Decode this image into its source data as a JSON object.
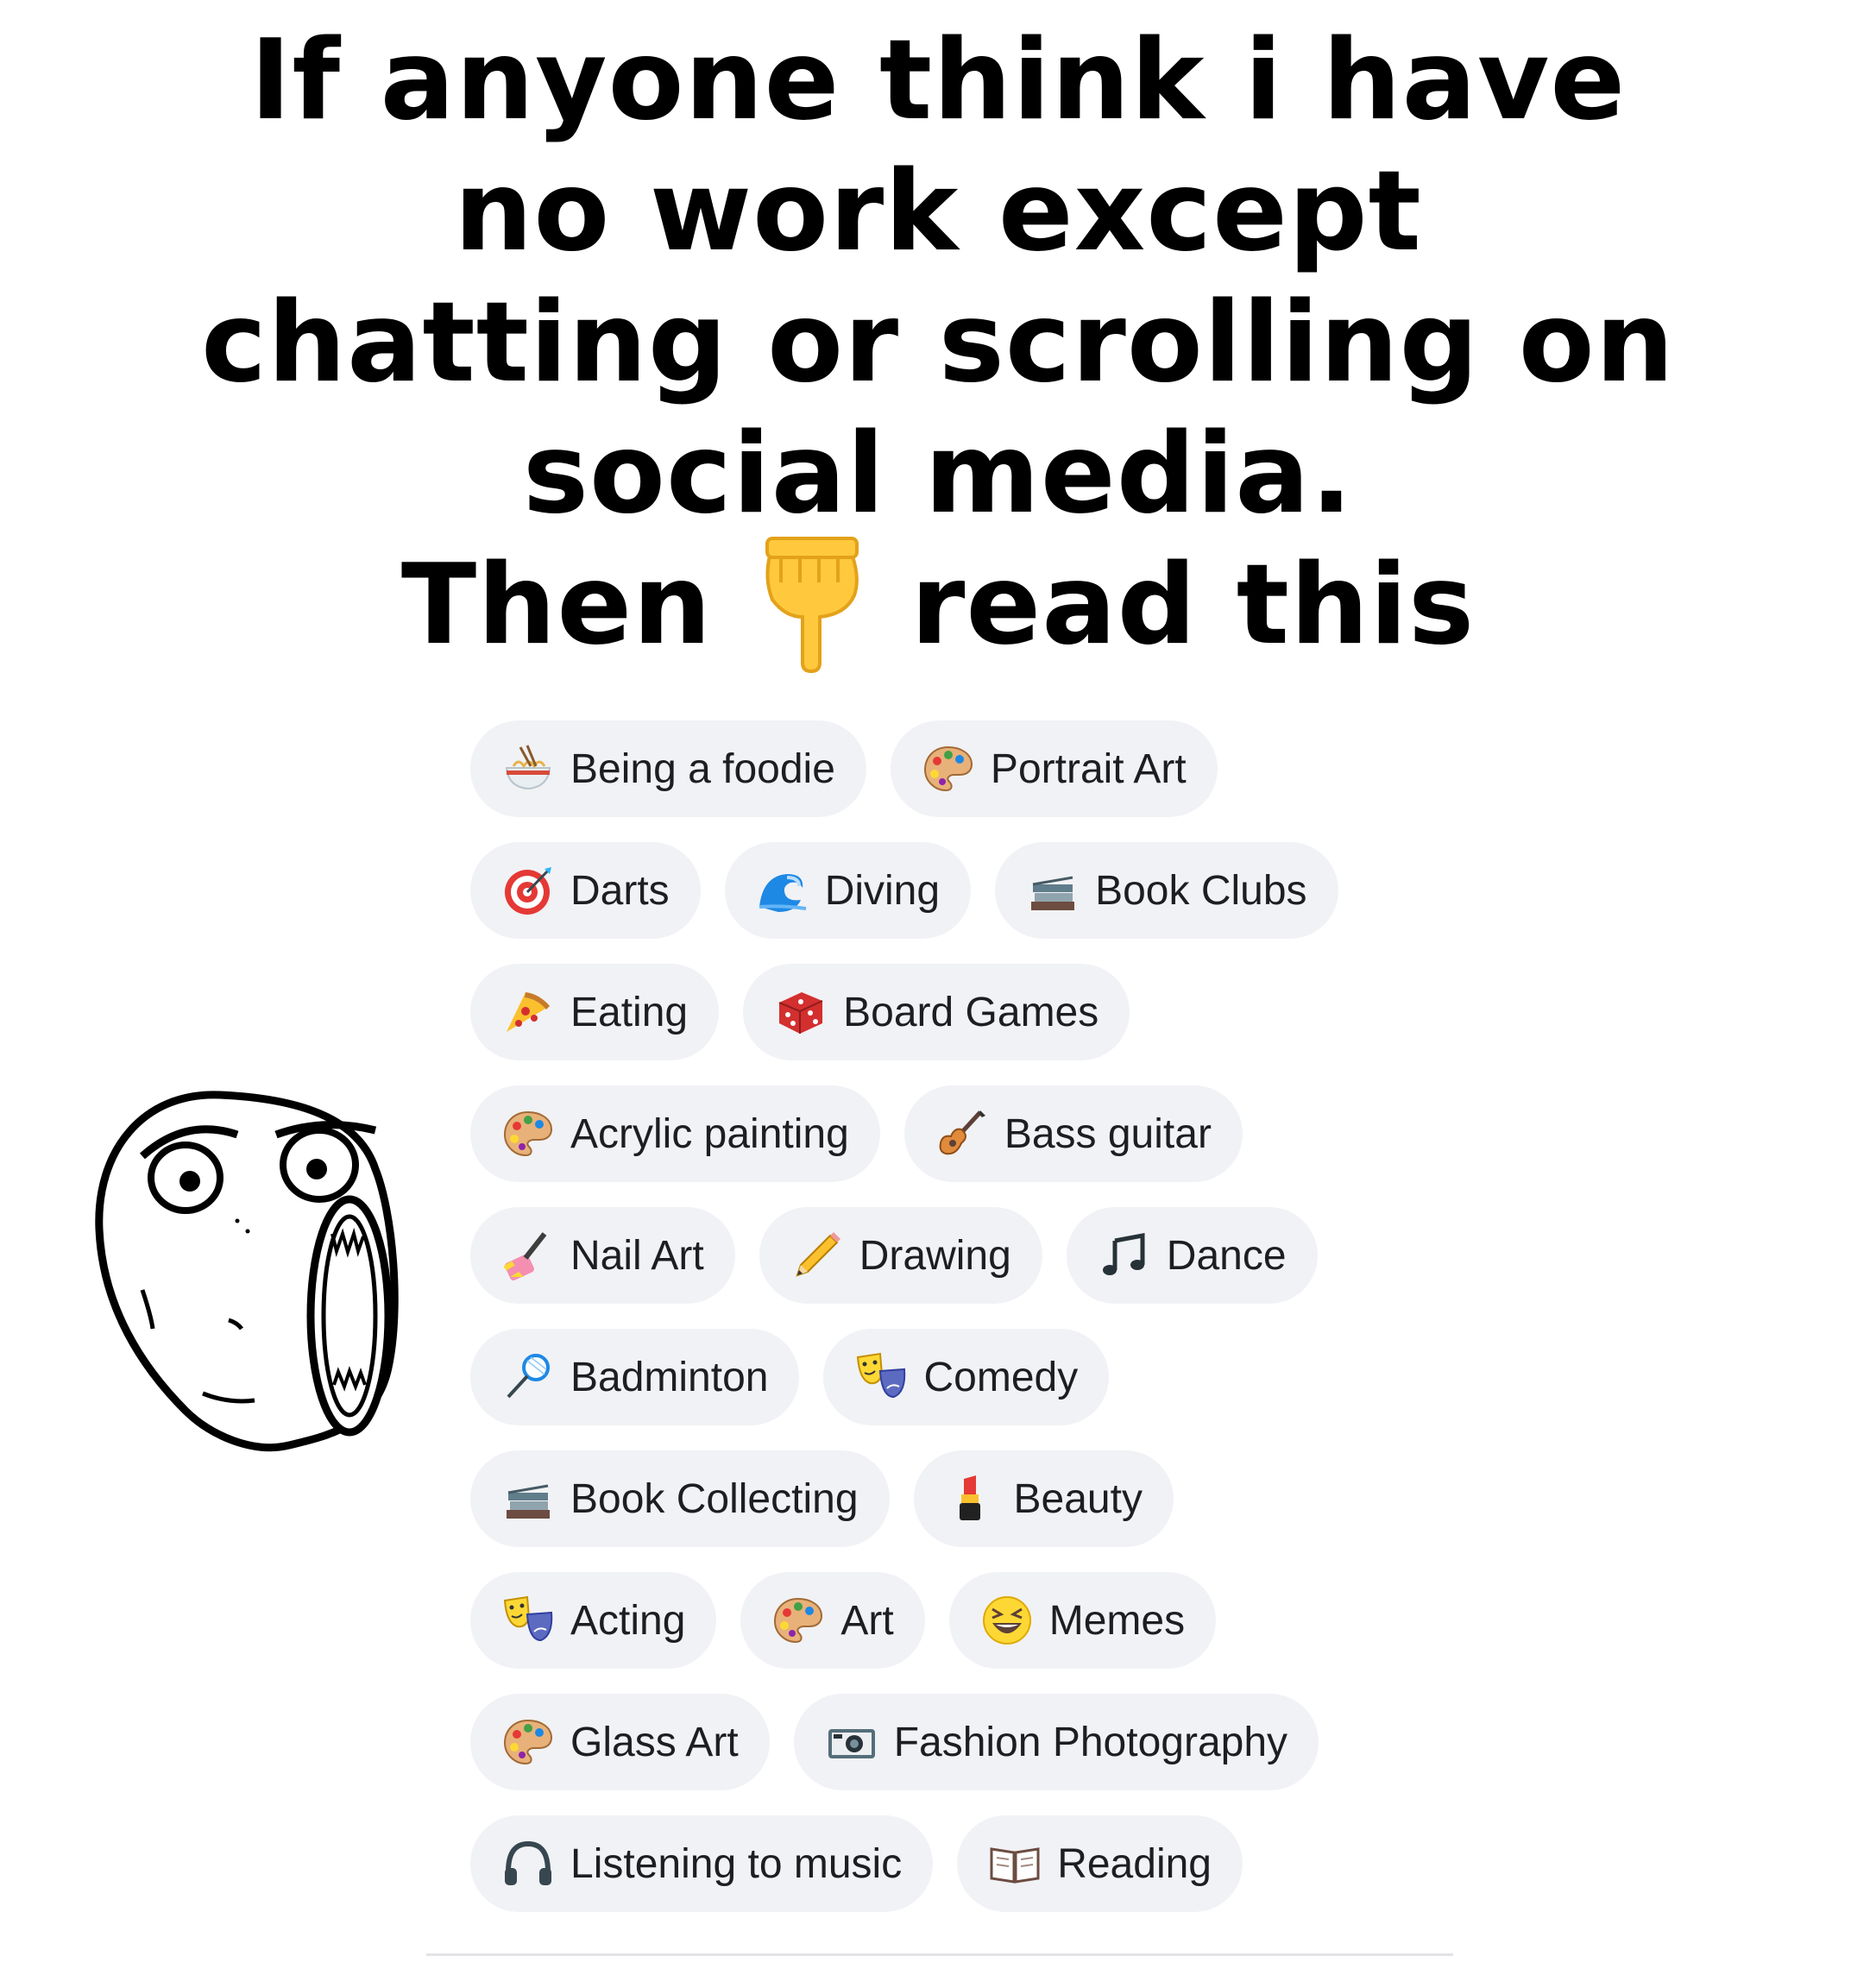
{
  "headline": {
    "line1": "If anyone think i have",
    "line2": "no work except",
    "line3": "chatting or scrolling on",
    "line4": "social media.",
    "line5_pre": "Then",
    "line5_icon": "backhand-index-pointing-down-emoji",
    "line5_post": "read this"
  },
  "interests": [
    [
      {
        "label": "Being a foodie",
        "icon": "noodle-bowl-icon"
      },
      {
        "label": "Portrait Art",
        "icon": "palette-icon"
      }
    ],
    [
      {
        "label": "Darts",
        "icon": "dart-target-icon"
      },
      {
        "label": "Diving",
        "icon": "wave-icon"
      },
      {
        "label": "Book Clubs",
        "icon": "books-icon"
      }
    ],
    [
      {
        "label": "Eating",
        "icon": "pizza-icon"
      },
      {
        "label": "Board Games",
        "icon": "dice-icon"
      }
    ],
    [
      {
        "label": "Acrylic painting",
        "icon": "palette-icon"
      },
      {
        "label": "Bass guitar",
        "icon": "guitar-icon"
      }
    ],
    [
      {
        "label": "Nail Art",
        "icon": "nail-polish-icon"
      },
      {
        "label": "Drawing",
        "icon": "pencil-icon"
      },
      {
        "label": "Dance",
        "icon": "music-note-icon"
      }
    ],
    [
      {
        "label": "Badminton",
        "icon": "badminton-icon"
      },
      {
        "label": "Comedy",
        "icon": "theater-masks-icon"
      }
    ],
    [
      {
        "label": "Book Collecting",
        "icon": "books-icon"
      },
      {
        "label": "Beauty",
        "icon": "lipstick-icon"
      }
    ],
    [
      {
        "label": "Acting",
        "icon": "theater-masks-icon"
      },
      {
        "label": "Art",
        "icon": "palette-icon"
      },
      {
        "label": "Memes",
        "icon": "laughing-face-icon"
      }
    ],
    [
      {
        "label": "Glass Art",
        "icon": "palette-icon"
      },
      {
        "label": "Fashion Photography",
        "icon": "camera-icon"
      }
    ],
    [
      {
        "label": "Listening to music",
        "icon": "headphones-icon"
      },
      {
        "label": "Reading",
        "icon": "open-book-icon"
      }
    ]
  ],
  "face_icon": "lol-rage-face"
}
